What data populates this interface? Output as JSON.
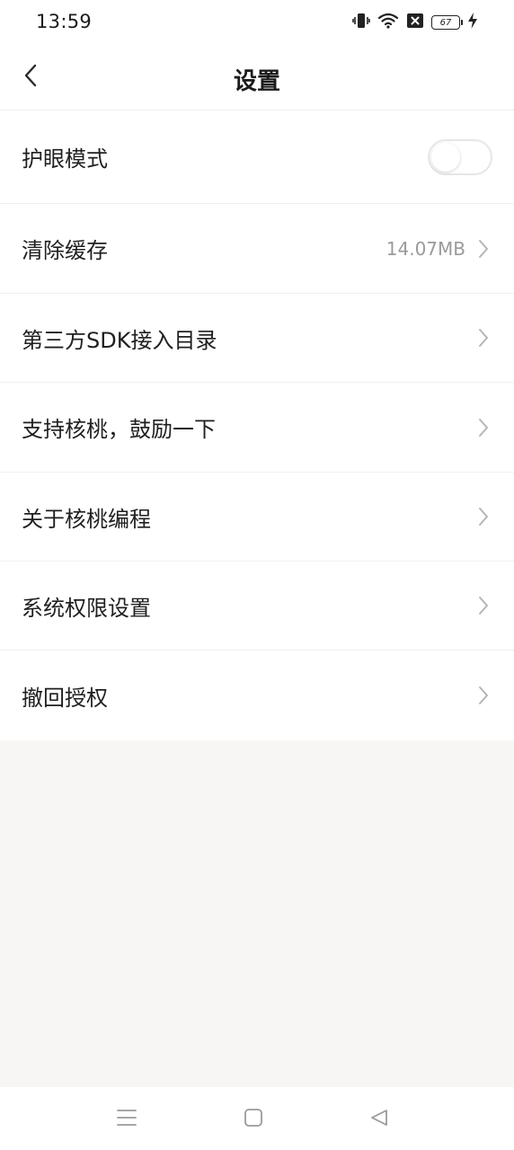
{
  "status_bar": {
    "time": "13:59",
    "battery_level": "67",
    "icons": [
      "vibrate-icon",
      "wifi-icon",
      "sim-off-icon",
      "battery-icon",
      "charging-icon"
    ]
  },
  "header": {
    "title": "设置",
    "back_icon": "chevron-left-icon"
  },
  "settings": {
    "eye_care": {
      "label": "护眼模式",
      "enabled": false
    },
    "clear_cache": {
      "label": "清除缓存",
      "value": "14.07MB"
    },
    "third_party_sdk": {
      "label": "第三方SDK接入目录"
    },
    "support": {
      "label": "支持核桃，鼓励一下"
    },
    "about": {
      "label": "关于核桃编程"
    },
    "permissions": {
      "label": "系统权限设置"
    },
    "revoke": {
      "label": "撤回授权"
    }
  },
  "nav_bar": {
    "buttons": [
      "menu-icon",
      "home-icon",
      "back-icon"
    ]
  },
  "colors": {
    "background": "#f8f6f4",
    "surface": "#ffffff",
    "text": "#1f1f1f",
    "secondary_text": "#9a9a9a",
    "chevron": "#b5b5b5"
  }
}
